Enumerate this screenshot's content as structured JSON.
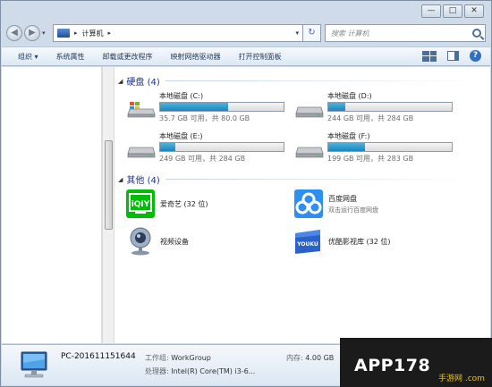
{
  "window": {
    "caption_buttons": [
      "—",
      "□",
      "✕"
    ]
  },
  "address": {
    "crumb": "计算机",
    "search_placeholder": "搜索 计算机"
  },
  "toolbar": {
    "items": [
      "组织 ▾",
      "系统属性",
      "卸载或更改程序",
      "映射网络驱动器",
      "打开控制面板"
    ]
  },
  "groups": {
    "hard_disks": "硬盘 (4)",
    "others": "其他 (4)"
  },
  "drives": [
    {
      "name": "本地磁盘 (C:)",
      "info": "35.7 GB 可用，共 80.0 GB",
      "used_fraction": 0.55
    },
    {
      "name": "本地磁盘 (D:)",
      "info": "244 GB 可用，共 284 GB",
      "used_fraction": 0.14
    },
    {
      "name": "本地磁盘 (E:)",
      "info": "249 GB 可用，共 284 GB",
      "used_fraction": 0.12
    },
    {
      "name": "本地磁盘 (F:)",
      "info": "199 GB 可用，共 283 GB",
      "used_fraction": 0.3
    }
  ],
  "others": [
    {
      "name": "爱奇艺 (32 位)",
      "sub": "",
      "icon": "iqiyi-icon"
    },
    {
      "name": "百度网盘",
      "sub": "双击运行百度网盘",
      "icon": "baidu-netdisk-icon"
    },
    {
      "name": "视频设备",
      "sub": "",
      "icon": "webcam-icon"
    },
    {
      "name": "优酷影视库 (32 位)",
      "sub": "",
      "icon": "youku-icon"
    }
  ],
  "details": {
    "pc_name": "PC-201611151644",
    "workgroup_label": "工作组:",
    "workgroup": "WorkGroup",
    "memory_label": "内存:",
    "memory": "4.00 GB",
    "cpu_label": "处理器:",
    "cpu": "Intel(R) Core(TM) i3-6..."
  },
  "watermark": {
    "brand": "APP178",
    "sub": "手游网 .com"
  },
  "colors": {
    "accent": "#1a86bf",
    "header_text": "#1e3287"
  }
}
